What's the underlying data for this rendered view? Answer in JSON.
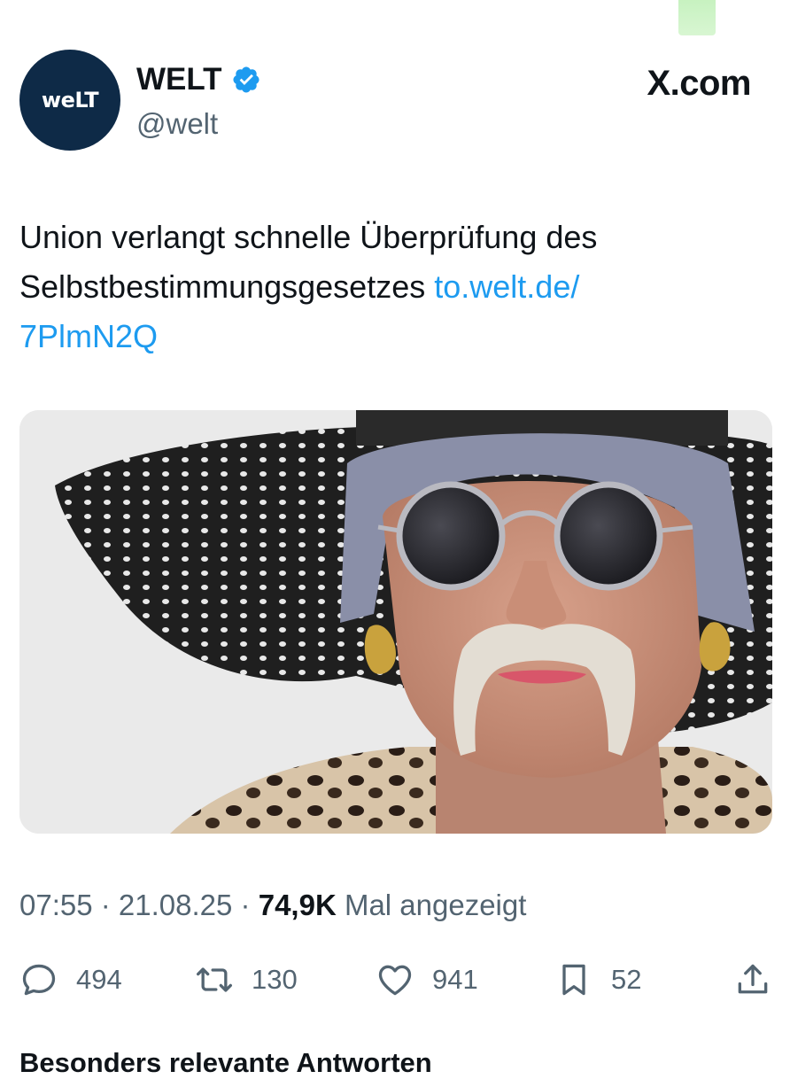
{
  "header": {
    "avatar_text": "weLT",
    "display_name": "WELT",
    "handle": "@welt",
    "source": "X.com"
  },
  "tweet": {
    "text": "Union verlangt schnelle Überprüfung des Selbstbestimmungsgesetzes",
    "link_part1": "to.welt.de/",
    "link_part2": "7PlmN2Q"
  },
  "meta": {
    "time": "07:55",
    "separator1": " · ",
    "date": "21.08.25",
    "separator2": " · ",
    "views_count": "74,9K",
    "views_label": " Mal angezeigt"
  },
  "actions": {
    "replies": "494",
    "reposts": "130",
    "likes": "941",
    "bookmarks": "52"
  },
  "replies_section": {
    "title": "Besonders relevante Antworten"
  },
  "colors": {
    "link": "#1d9bf0",
    "verified": "#1d9bf0",
    "avatar_bg": "#0e2a47",
    "secondary_text": "#536471"
  }
}
